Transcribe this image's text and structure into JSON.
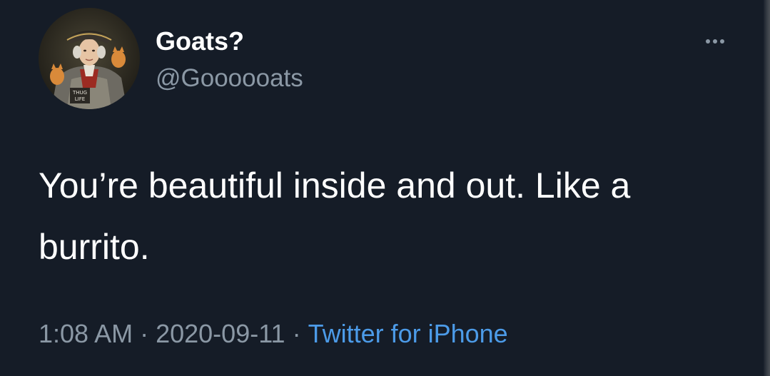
{
  "author": {
    "display_name": "Goats?",
    "handle": "@Goooooats",
    "avatar_caption": [
      "THUG",
      "LIFE"
    ]
  },
  "more_icon": "ellipsis-icon",
  "tweet": {
    "text_lines": [
      "You’re beautiful inside and out. Like a",
      "burrito."
    ]
  },
  "meta": {
    "time": "1:08 AM",
    "separator": "·",
    "date": "2020-09-11",
    "source": "Twitter for iPhone"
  },
  "colors": {
    "background": "#151c27",
    "text": "#ffffff",
    "secondary": "#8b98a5",
    "link": "#4c9be8"
  }
}
